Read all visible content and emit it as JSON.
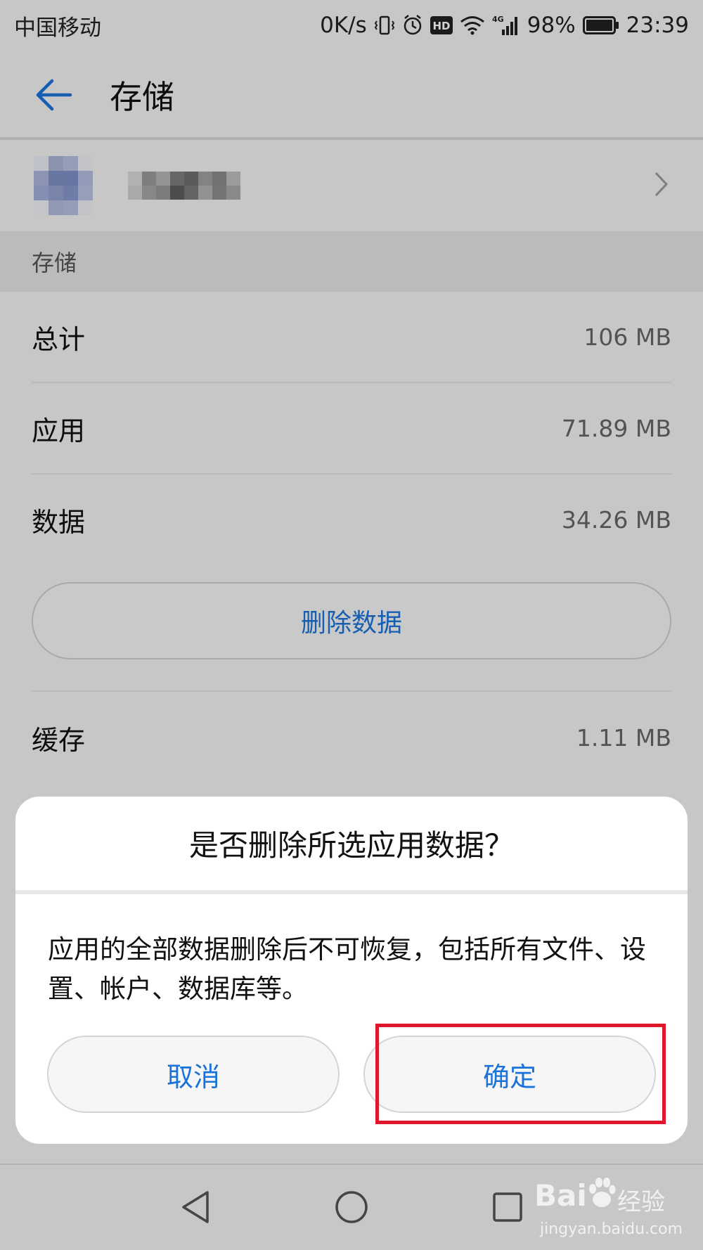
{
  "status_bar": {
    "carrier": "中国移动",
    "speed": "0K/s",
    "hd": "HD",
    "network": "4G",
    "battery": "98%",
    "time": "23:39"
  },
  "header": {
    "title": "存储"
  },
  "storage_section": {
    "header": "存储"
  },
  "rows": [
    {
      "label": "总计",
      "value": "106 MB"
    },
    {
      "label": "应用",
      "value": "71.89 MB"
    },
    {
      "label": "数据",
      "value": "34.26 MB"
    },
    {
      "label": "缓存",
      "value": "1.11 MB"
    }
  ],
  "delete_data_button": "删除数据",
  "dialog": {
    "title": "是否删除所选应用数据？",
    "message": "应用的全部数据删除后不可恢复，包括所有文件、设置、帐户、数据库等。",
    "cancel": "取消",
    "confirm": "确定"
  },
  "watermark": {
    "brand": "Bai",
    "suffix": "经验",
    "url": "jingyan.baidu.com"
  },
  "colors": {
    "accent": "#1a73d9",
    "highlight": "#e0162b"
  }
}
